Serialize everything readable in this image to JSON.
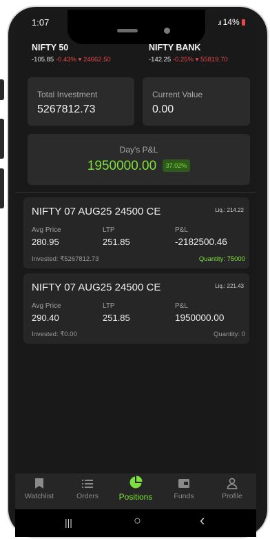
{
  "status_bar": {
    "time": "1:07",
    "battery": "14%"
  },
  "tickers": [
    {
      "name": "NIFTY 50",
      "change": "-105.85",
      "percent": "-0.43%",
      "arrow": "▾",
      "value": "24662.50"
    },
    {
      "name": "NIFTY BANK",
      "change": "-142.25",
      "percent": "-0.25%",
      "arrow": "▾",
      "value": "55819.70"
    }
  ],
  "summary": {
    "total_investment_label": "Total Investment",
    "total_investment_value": "5267812.73",
    "current_value_label": "Current Value",
    "current_value_value": "0.00",
    "day_pnl_label": "Day's P&L",
    "day_pnl_value": "1950000.00",
    "day_pnl_percent": "37.02%"
  },
  "positions": [
    {
      "title": "NIFTY 07 AUG25 24500 CE",
      "liq": "Liq.: 214.22",
      "avg_label": "Avg Price",
      "avg_value": "280.95",
      "ltp_label": "LTP",
      "ltp_value": "251.85",
      "pnl_label": "P&L",
      "pnl_value": "-2182500.46",
      "invested": "Invested: ₹5267812.73",
      "quantity": "Quantity: 75000"
    },
    {
      "title": "NIFTY 07 AUG25 24500 CE",
      "liq": "Liq.: 221.43",
      "avg_label": "Avg Price",
      "avg_value": "290.40",
      "ltp_label": "LTP",
      "ltp_value": "251.85",
      "pnl_label": "P&L",
      "pnl_value": "1950000.00",
      "invested": "Invested: ₹0.00",
      "quantity": "Quantity: 0"
    }
  ],
  "tabs": [
    {
      "label": "Watchlist",
      "icon": "bookmark-icon"
    },
    {
      "label": "Orders",
      "icon": "list-icon"
    },
    {
      "label": "Positions",
      "icon": "pie-chart-icon"
    },
    {
      "label": "Funds",
      "icon": "wallet-icon"
    },
    {
      "label": "Profile",
      "icon": "person-icon"
    }
  ],
  "active_tab": "Positions",
  "navbar": {
    "recents": "|||",
    "home": "○",
    "back": "‹"
  },
  "colors": {
    "profit": "#7ee03c",
    "loss": "#e5484d",
    "background": "#191919",
    "card": "#2b2b2b"
  }
}
